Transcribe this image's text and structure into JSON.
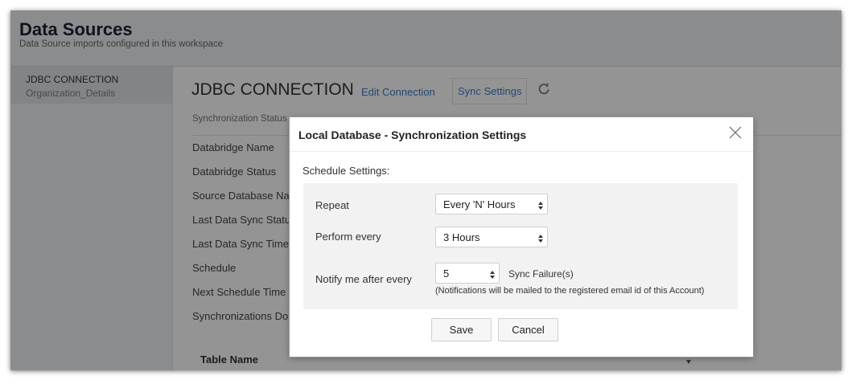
{
  "header": {
    "title": "Data Sources",
    "subtitle": "Data Source imports configured in this workspace"
  },
  "sidebar": {
    "items": [
      {
        "title": "JDBC CONNECTION",
        "subtitle": "Organization_Details"
      }
    ]
  },
  "main": {
    "title": "JDBC CONNECTION",
    "edit_link": "Edit Connection",
    "sync_settings_link": "Sync Settings",
    "refresh_icon": "refresh-icon",
    "sync_status_label": "Synchronization Status",
    "fields": [
      "Databridge Name",
      "Databridge Status",
      "Source Database Na",
      "Last Data Sync Statu",
      "Last Data Sync Time",
      "Schedule",
      "Next Schedule Time",
      "Synchronizations Do"
    ],
    "table_header": "Table Name"
  },
  "dialog": {
    "title": "Local Database - Synchronization Settings",
    "close_icon": "close-icon",
    "schedule_label": "Schedule Settings:",
    "repeat_label": "Repeat",
    "repeat_value": "Every 'N' Hours",
    "perform_label": "Perform every",
    "perform_value": "3 Hours",
    "notify_label": "Notify me after every",
    "notify_value": "5",
    "failure_label": "Sync Failure(s)",
    "notify_note": "(Notifications will be mailed to the registered email id of this Account)",
    "save_label": "Save",
    "cancel_label": "Cancel"
  },
  "colors": {
    "link": "#3f7cc9",
    "header_bg": "#f0f1f3",
    "overlay": "rgba(0,0,0,0.42)"
  }
}
